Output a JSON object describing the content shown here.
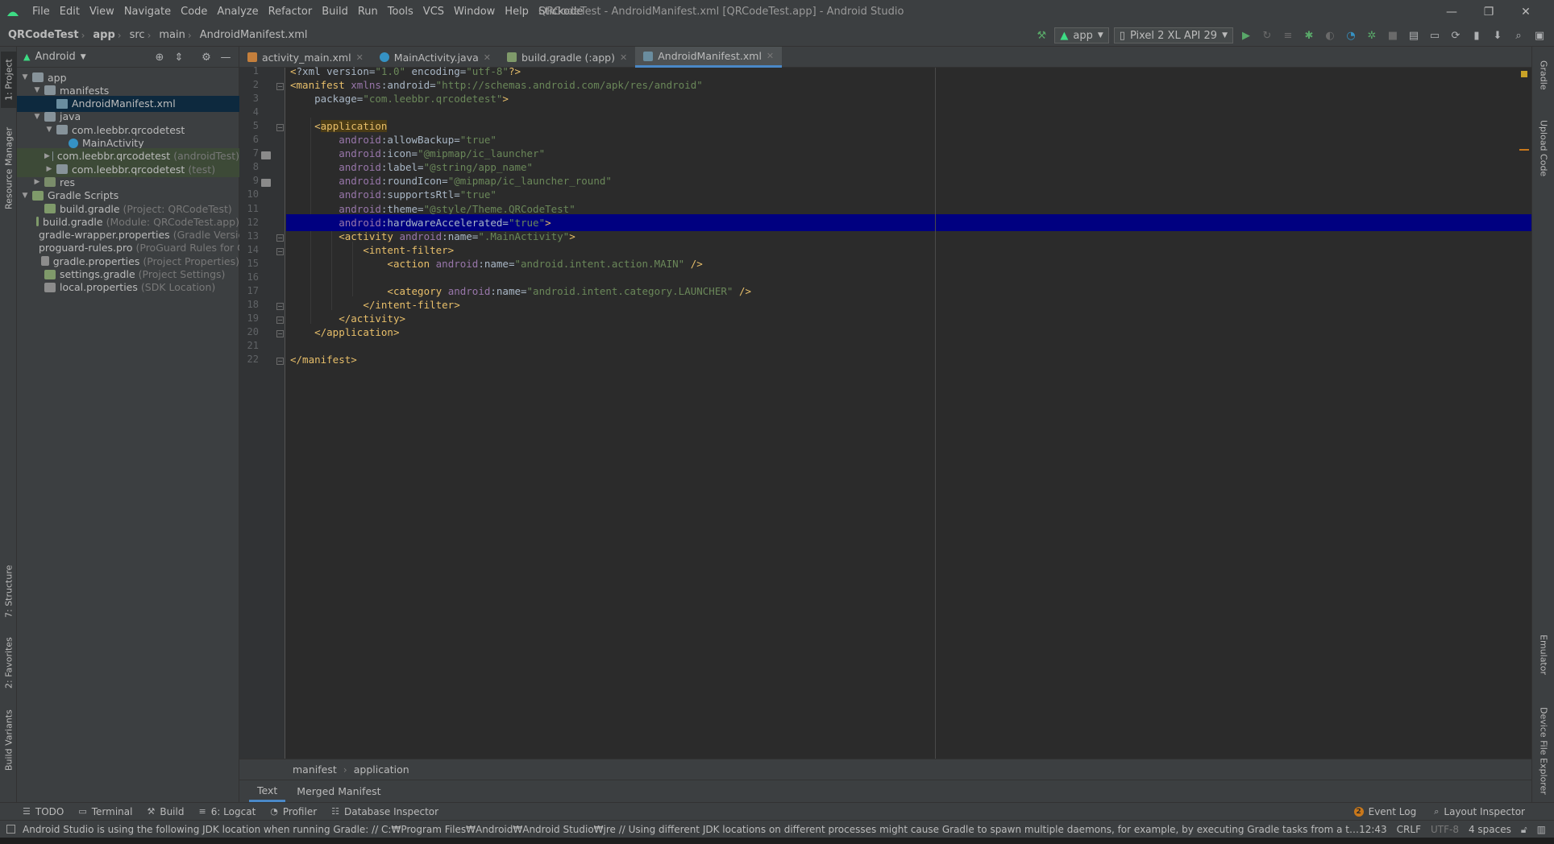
{
  "window": {
    "title": "QRCodeTest - AndroidManifest.xml [QRCodeTest.app] - Android Studio",
    "menu": [
      "File",
      "Edit",
      "View",
      "Navigate",
      "Code",
      "Analyze",
      "Refactor",
      "Build",
      "Run",
      "Tools",
      "VCS",
      "Window",
      "Help",
      "Stickode"
    ],
    "controls": {
      "minimize": "—",
      "maximize": "❐",
      "close": "✕"
    }
  },
  "breadcrumb": [
    "QRCodeTest",
    "app",
    "src",
    "main",
    "AndroidManifest.xml"
  ],
  "toolbar": {
    "run_config": "app",
    "device": "Pixel 2 XL API 29"
  },
  "left_stripe": {
    "project": "1: Project",
    "resource_manager": "Resource Manager",
    "structure": "7: Structure",
    "favorites": "2: Favorites",
    "build_variants": "Build Variants"
  },
  "right_stripe": {
    "gradle": "Gradle",
    "upload_code": "Upload Code",
    "emulator": "Emulator",
    "device_file_explorer": "Device File Explorer"
  },
  "project_panel": {
    "view_mode": "Android",
    "tree": [
      {
        "label": "app",
        "hint": "",
        "icon": "folder-icon"
      },
      {
        "label": "manifests",
        "hint": "",
        "icon": "folder-icon"
      },
      {
        "label": "AndroidManifest.xml",
        "hint": "",
        "icon": "xml-file-icon"
      },
      {
        "label": "java",
        "hint": "",
        "icon": "folder-icon"
      },
      {
        "label": "com.leebbr.qrcodetest",
        "hint": "",
        "icon": "package-icon"
      },
      {
        "label": "MainActivity",
        "hint": "",
        "icon": "class-icon"
      },
      {
        "label": "com.leebbr.qrcodetest",
        "hint": "(androidTest)",
        "icon": "package-icon"
      },
      {
        "label": "com.leebbr.qrcodetest",
        "hint": "(test)",
        "icon": "package-icon"
      },
      {
        "label": "res",
        "hint": "",
        "icon": "res-folder-icon"
      },
      {
        "label": "Gradle Scripts",
        "hint": "",
        "icon": "gradle-icon"
      },
      {
        "label": "build.gradle",
        "hint": "(Project: QRCodeTest)",
        "icon": "gradle-icon"
      },
      {
        "label": "build.gradle",
        "hint": "(Module: QRCodeTest.app)",
        "icon": "gradle-icon"
      },
      {
        "label": "gradle-wrapper.properties",
        "hint": "(Gradle Version)",
        "icon": "properties-icon"
      },
      {
        "label": "proguard-rules.pro",
        "hint": "(ProGuard Rules for QRCodeTest.app)",
        "icon": "properties-icon"
      },
      {
        "label": "gradle.properties",
        "hint": "(Project Properties)",
        "icon": "properties-icon"
      },
      {
        "label": "settings.gradle",
        "hint": "(Project Settings)",
        "icon": "gradle-icon"
      },
      {
        "label": "local.properties",
        "hint": "(SDK Location)",
        "icon": "properties-icon"
      }
    ]
  },
  "tabs": [
    {
      "label": "activity_main.xml",
      "active": false
    },
    {
      "label": "MainActivity.java",
      "active": false
    },
    {
      "label": "build.gradle (:app)",
      "active": false
    },
    {
      "label": "AndroidManifest.xml",
      "active": true
    }
  ],
  "editor": {
    "current_line": 12,
    "lines": [
      "<?xml version=\"1.0\" encoding=\"utf-8\"?>",
      "<manifest xmlns:android=\"http://schemas.android.com/apk/res/android\"",
      "    package=\"com.leebbr.qrcodetest\">",
      "",
      "    <application",
      "        android:allowBackup=\"true\"",
      "        android:icon=\"@mipmap/ic_launcher\"",
      "        android:label=\"@string/app_name\"",
      "        android:roundIcon=\"@mipmap/ic_launcher_round\"",
      "        android:supportsRtl=\"true\"",
      "        android:theme=\"@style/Theme.QRCodeTest\"",
      "        android:hardwareAccelerated=\"true\">",
      "        <activity android:name=\".MainActivity\">",
      "            <intent-filter>",
      "                <action android:name=\"android.intent.action.MAIN\" />",
      "",
      "                <category android:name=\"android.intent.category.LAUNCHER\" />",
      "            </intent-filter>",
      "        </activity>",
      "    </application>",
      "",
      "</manifest>"
    ]
  },
  "editor_breadcrumb": [
    "manifest",
    "application"
  ],
  "editor_bottom_tabs": [
    {
      "label": "Text",
      "active": true
    },
    {
      "label": "Merged Manifest",
      "active": false
    }
  ],
  "tool_windows": [
    "TODO",
    "Terminal",
    "Build",
    "6: Logcat",
    "Profiler",
    "Database Inspector"
  ],
  "tool_windows_right": {
    "event_log": "Event Log",
    "event_count": "2",
    "layout_inspector": "Layout Inspector"
  },
  "status": {
    "message": "Android Studio is using the following JDK location when running Gradle: // C:₩Program Files₩Android₩Android Studio₩jre // Using different JDK locations on different processes might cause Gradle to spawn multiple daemons, for example, by executing Gradle tasks from a terminal while... (a minute ago)",
    "position": "12:43",
    "line_sep": "CRLF",
    "encoding": "UTF-8",
    "indent": "4 spaces"
  },
  "colors": {
    "accent": "#4a88c7",
    "caret_row": "#000080",
    "tag": "#e8bf6a",
    "value": "#6a8759",
    "namespace": "#9876aa"
  }
}
